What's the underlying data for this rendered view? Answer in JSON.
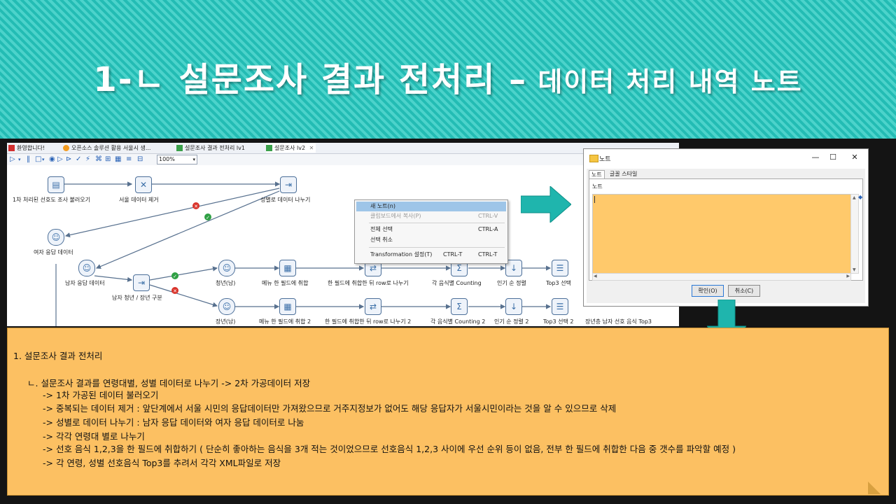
{
  "slide": {
    "title_main": "1-ㄴ 설문조사 결과 전처리 –",
    "title_sub": " 데이터 처리 내역 노트"
  },
  "editor": {
    "tabs": [
      {
        "label": "환영합니다!"
      },
      {
        "label": "오픈소스 솔루션 활용 서울시 생..."
      },
      {
        "label": "설문조사 결과 전처리 lv1"
      },
      {
        "label": "설문조사 lv2",
        "close": "✕"
      }
    ],
    "zoom": "100%",
    "nodes": {
      "load": "1차 처리된 선호도 조사 불러오기",
      "remove_seoul": "서울 데이터 제거",
      "split_gender": "성별로 데이터 나누기",
      "female": "여자 응답 데이터",
      "male": "남자 응답 데이터",
      "split_age": "남자 청년 / 장년 구분",
      "young": "청년(남)",
      "menu_one": "메뉴 한 필드에 취합",
      "row_split": "한 필드에 취합한 뒤 row로 나누기",
      "count": "각 음식별 Counting",
      "sort": "인기 순 정렬",
      "top3": "Top3 선택",
      "old": "장년(남)",
      "menu_one2": "메뉴 한 필드에 취합 2",
      "row_split2": "한 필드에 취합한 뒤 row로 나누기 2",
      "count2": "각 음식별 Counting 2",
      "sort2": "인기 순 정렬 2",
      "top3_2": "Top3 선택 2",
      "out_xml": "장년층 남자 선호 음식 Top3"
    },
    "context_menu": [
      {
        "label": "새 노트(n)",
        "shortcut": ""
      },
      {
        "label": "클립보드에서 복사(P)",
        "shortcut": "CTRL-V"
      },
      {
        "label": "전체 선택",
        "shortcut": "CTRL-A"
      },
      {
        "label": "선택 취소",
        "shortcut": ""
      },
      {
        "label": "Transformation 설정(T)",
        "shortcut": "CTRL-T",
        "shortcut2": "CTRL-T"
      }
    ]
  },
  "dialog": {
    "title": "노트",
    "tabs": [
      "노트",
      "글꼴 스타일"
    ],
    "field_label": "노트",
    "ok": "확인(O)",
    "cancel": "취소(C)"
  },
  "note": {
    "lines": [
      "1. 설문조사 결과 전처리",
      "ㄴ. 설문조사 결과를 연령대별, 성별 데이터로 나누기 -> 2차 가공데이터 저장",
      "-> 1차 가공된 데이터 불러오기",
      "-> 중복되는 데이터 제거 : 앞단계에서 서울 시민의 응답데이터만 가져왔으므로 거주지정보가 없어도 해당 응답자가 서울시민이라는 것을 알 수 있으므로 삭제",
      "-> 성별로 데이터 나누기 : 남자 응답 데이터와 여자 응답 데이터로 나눔",
      "-> 각각 연령대 별로 나누기",
      "-> 선호 음식 1,2,3을 한 필드에 취합하기 ( 단순히 좋아하는 음식을 3개 적는 것이었으므로 선호음식 1,2,3 사이에 우선 순위 등이 없음, 전부 한 필드에 취합한 다음 중 갯수를 파악할 예정 )",
      "-> 각 연령, 성별 선호음식 Top3를 추려서 각각 XML파일로 저장"
    ]
  },
  "colors": {
    "banner": "#23bcb4",
    "arrow": "#1fb5ad",
    "note_bg": "#fcc062",
    "note_area": "#ffc96b"
  }
}
